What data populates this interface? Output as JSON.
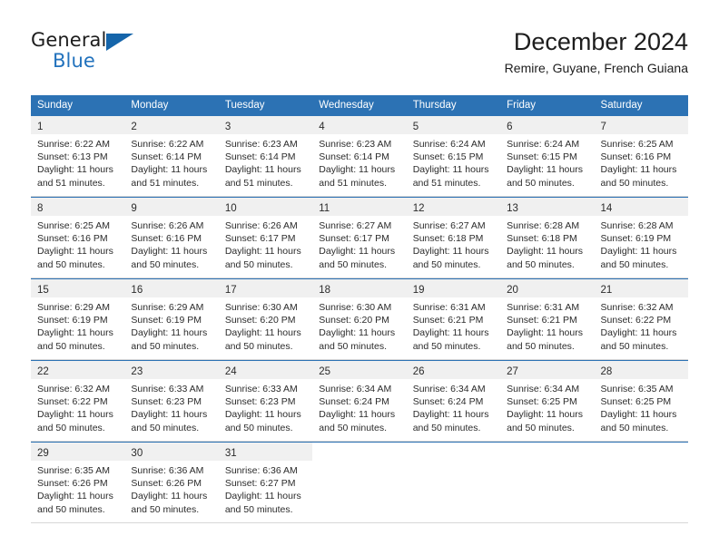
{
  "brand": {
    "name_part1": "General",
    "name_part2": "Blue",
    "flag_icon": "brand-triangle-icon"
  },
  "header": {
    "title": "December 2024",
    "subtitle": "Remire, Guyane, French Guiana"
  },
  "colors": {
    "header_blue": "#2c72b4",
    "brand_blue": "#2272bd",
    "daynum_bg": "#f0f0f0",
    "row_divider": "#d8d8d8"
  },
  "calendar": {
    "weekdays": [
      "Sunday",
      "Monday",
      "Tuesday",
      "Wednesday",
      "Thursday",
      "Friday",
      "Saturday"
    ],
    "weeks": [
      [
        {
          "day": "1",
          "lines": [
            "Sunrise: 6:22 AM",
            "Sunset: 6:13 PM",
            "Daylight: 11 hours",
            "and 51 minutes."
          ]
        },
        {
          "day": "2",
          "lines": [
            "Sunrise: 6:22 AM",
            "Sunset: 6:14 PM",
            "Daylight: 11 hours",
            "and 51 minutes."
          ]
        },
        {
          "day": "3",
          "lines": [
            "Sunrise: 6:23 AM",
            "Sunset: 6:14 PM",
            "Daylight: 11 hours",
            "and 51 minutes."
          ]
        },
        {
          "day": "4",
          "lines": [
            "Sunrise: 6:23 AM",
            "Sunset: 6:14 PM",
            "Daylight: 11 hours",
            "and 51 minutes."
          ]
        },
        {
          "day": "5",
          "lines": [
            "Sunrise: 6:24 AM",
            "Sunset: 6:15 PM",
            "Daylight: 11 hours",
            "and 51 minutes."
          ]
        },
        {
          "day": "6",
          "lines": [
            "Sunrise: 6:24 AM",
            "Sunset: 6:15 PM",
            "Daylight: 11 hours",
            "and 50 minutes."
          ]
        },
        {
          "day": "7",
          "lines": [
            "Sunrise: 6:25 AM",
            "Sunset: 6:16 PM",
            "Daylight: 11 hours",
            "and 50 minutes."
          ]
        }
      ],
      [
        {
          "day": "8",
          "lines": [
            "Sunrise: 6:25 AM",
            "Sunset: 6:16 PM",
            "Daylight: 11 hours",
            "and 50 minutes."
          ]
        },
        {
          "day": "9",
          "lines": [
            "Sunrise: 6:26 AM",
            "Sunset: 6:16 PM",
            "Daylight: 11 hours",
            "and 50 minutes."
          ]
        },
        {
          "day": "10",
          "lines": [
            "Sunrise: 6:26 AM",
            "Sunset: 6:17 PM",
            "Daylight: 11 hours",
            "and 50 minutes."
          ]
        },
        {
          "day": "11",
          "lines": [
            "Sunrise: 6:27 AM",
            "Sunset: 6:17 PM",
            "Daylight: 11 hours",
            "and 50 minutes."
          ]
        },
        {
          "day": "12",
          "lines": [
            "Sunrise: 6:27 AM",
            "Sunset: 6:18 PM",
            "Daylight: 11 hours",
            "and 50 minutes."
          ]
        },
        {
          "day": "13",
          "lines": [
            "Sunrise: 6:28 AM",
            "Sunset: 6:18 PM",
            "Daylight: 11 hours",
            "and 50 minutes."
          ]
        },
        {
          "day": "14",
          "lines": [
            "Sunrise: 6:28 AM",
            "Sunset: 6:19 PM",
            "Daylight: 11 hours",
            "and 50 minutes."
          ]
        }
      ],
      [
        {
          "day": "15",
          "lines": [
            "Sunrise: 6:29 AM",
            "Sunset: 6:19 PM",
            "Daylight: 11 hours",
            "and 50 minutes."
          ]
        },
        {
          "day": "16",
          "lines": [
            "Sunrise: 6:29 AM",
            "Sunset: 6:19 PM",
            "Daylight: 11 hours",
            "and 50 minutes."
          ]
        },
        {
          "day": "17",
          "lines": [
            "Sunrise: 6:30 AM",
            "Sunset: 6:20 PM",
            "Daylight: 11 hours",
            "and 50 minutes."
          ]
        },
        {
          "day": "18",
          "lines": [
            "Sunrise: 6:30 AM",
            "Sunset: 6:20 PM",
            "Daylight: 11 hours",
            "and 50 minutes."
          ]
        },
        {
          "day": "19",
          "lines": [
            "Sunrise: 6:31 AM",
            "Sunset: 6:21 PM",
            "Daylight: 11 hours",
            "and 50 minutes."
          ]
        },
        {
          "day": "20",
          "lines": [
            "Sunrise: 6:31 AM",
            "Sunset: 6:21 PM",
            "Daylight: 11 hours",
            "and 50 minutes."
          ]
        },
        {
          "day": "21",
          "lines": [
            "Sunrise: 6:32 AM",
            "Sunset: 6:22 PM",
            "Daylight: 11 hours",
            "and 50 minutes."
          ]
        }
      ],
      [
        {
          "day": "22",
          "lines": [
            "Sunrise: 6:32 AM",
            "Sunset: 6:22 PM",
            "Daylight: 11 hours",
            "and 50 minutes."
          ]
        },
        {
          "day": "23",
          "lines": [
            "Sunrise: 6:33 AM",
            "Sunset: 6:23 PM",
            "Daylight: 11 hours",
            "and 50 minutes."
          ]
        },
        {
          "day": "24",
          "lines": [
            "Sunrise: 6:33 AM",
            "Sunset: 6:23 PM",
            "Daylight: 11 hours",
            "and 50 minutes."
          ]
        },
        {
          "day": "25",
          "lines": [
            "Sunrise: 6:34 AM",
            "Sunset: 6:24 PM",
            "Daylight: 11 hours",
            "and 50 minutes."
          ]
        },
        {
          "day": "26",
          "lines": [
            "Sunrise: 6:34 AM",
            "Sunset: 6:24 PM",
            "Daylight: 11 hours",
            "and 50 minutes."
          ]
        },
        {
          "day": "27",
          "lines": [
            "Sunrise: 6:34 AM",
            "Sunset: 6:25 PM",
            "Daylight: 11 hours",
            "and 50 minutes."
          ]
        },
        {
          "day": "28",
          "lines": [
            "Sunrise: 6:35 AM",
            "Sunset: 6:25 PM",
            "Daylight: 11 hours",
            "and 50 minutes."
          ]
        }
      ],
      [
        {
          "day": "29",
          "lines": [
            "Sunrise: 6:35 AM",
            "Sunset: 6:26 PM",
            "Daylight: 11 hours",
            "and 50 minutes."
          ]
        },
        {
          "day": "30",
          "lines": [
            "Sunrise: 6:36 AM",
            "Sunset: 6:26 PM",
            "Daylight: 11 hours",
            "and 50 minutes."
          ]
        },
        {
          "day": "31",
          "lines": [
            "Sunrise: 6:36 AM",
            "Sunset: 6:27 PM",
            "Daylight: 11 hours",
            "and 50 minutes."
          ]
        },
        {
          "day": "",
          "lines": []
        },
        {
          "day": "",
          "lines": []
        },
        {
          "day": "",
          "lines": []
        },
        {
          "day": "",
          "lines": []
        }
      ]
    ]
  }
}
